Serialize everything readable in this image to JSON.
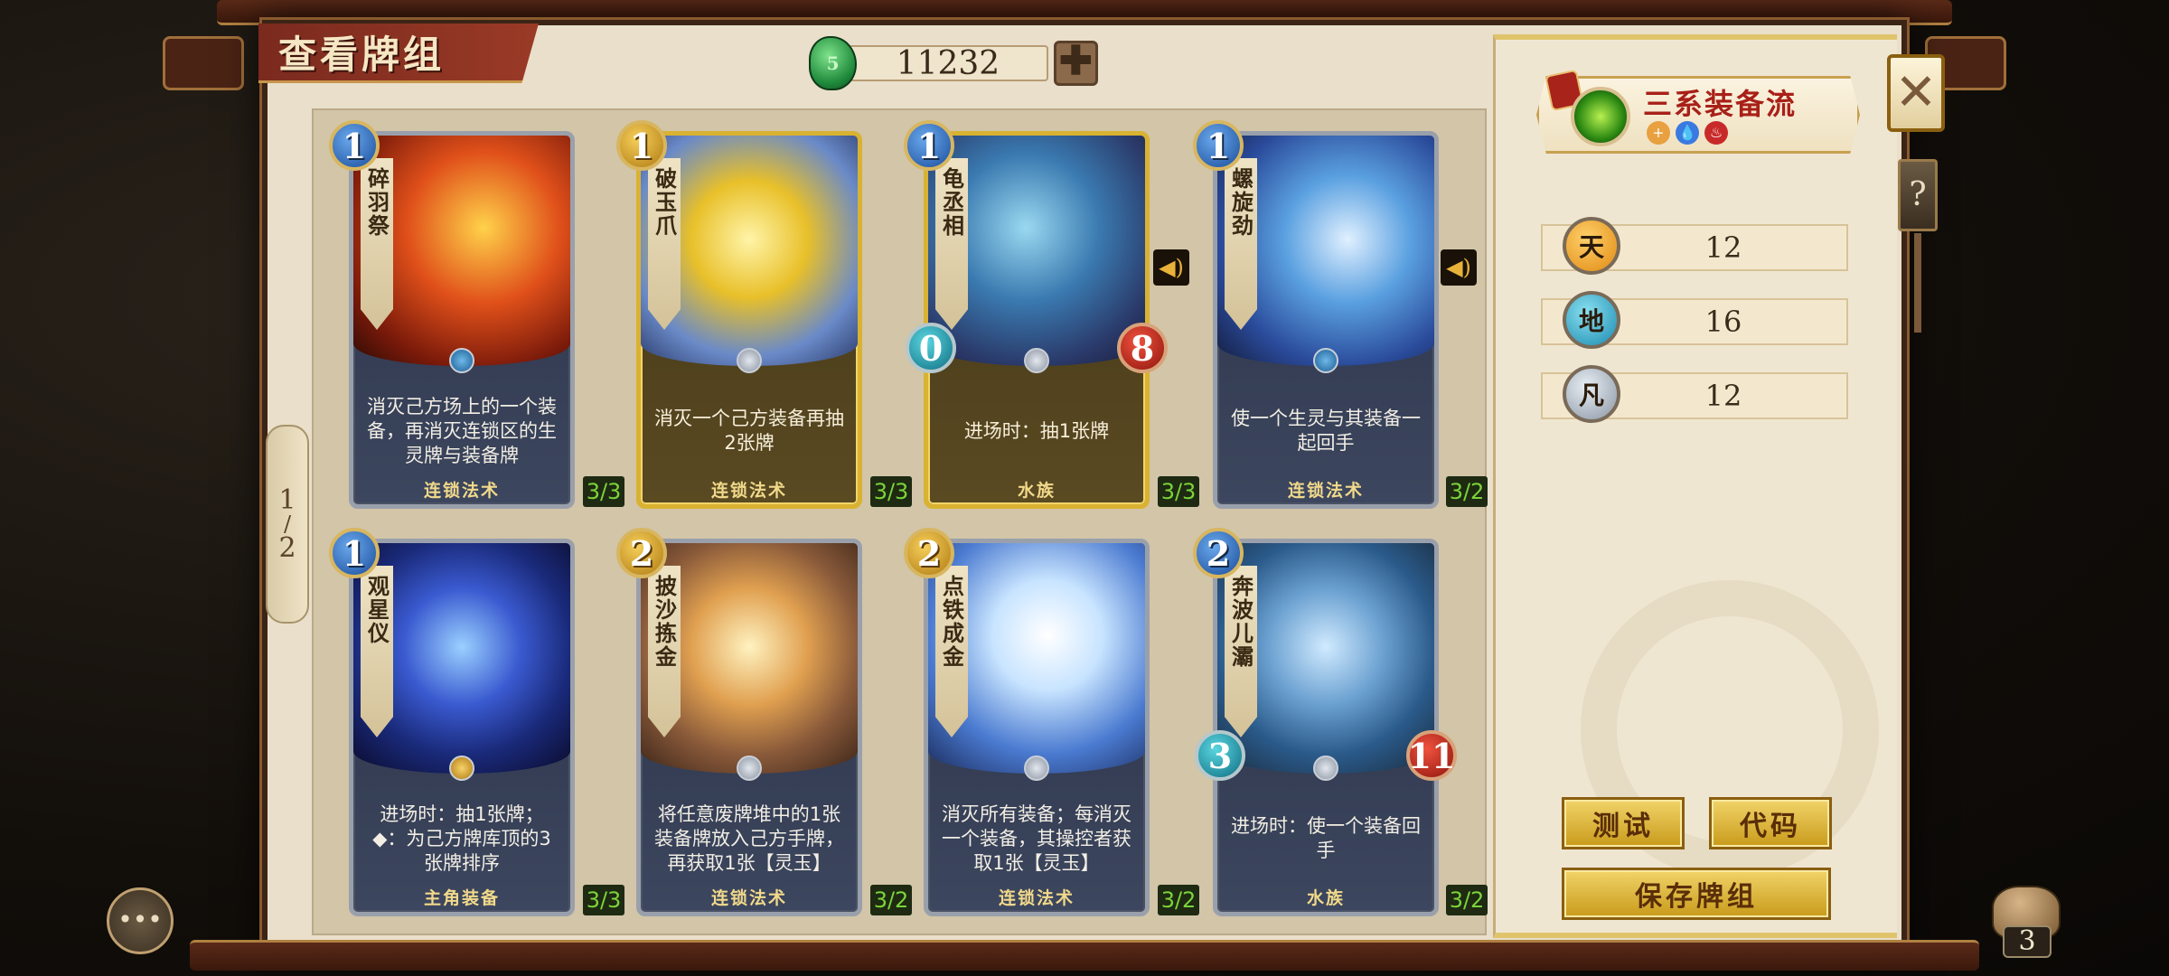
{
  "title": "查看牌组",
  "currency": {
    "jade_icon": "5",
    "amount": "11232",
    "add_label": "✚"
  },
  "pager": {
    "current": "1",
    "total": "2"
  },
  "cards": [
    {
      "name": "碎羽祭",
      "cost": "1",
      "desc": "消灭己方场上的一个装备，再消灭连锁区的生灵牌与装备牌",
      "type": "连锁法术",
      "count": "3/3"
    },
    {
      "name": "破玉爪",
      "cost": "1",
      "desc": "消灭一个己方装备再抽2张牌",
      "type": "连锁法术",
      "count": "3/3"
    },
    {
      "name": "龟丞相",
      "cost": "1",
      "atk": "0",
      "hp": "8",
      "desc": "进场时：抽1张牌",
      "type": "水族",
      "count": "3/3"
    },
    {
      "name": "螺旋劲",
      "cost": "1",
      "desc": "使一个生灵与其装备一起回手",
      "type": "连锁法术",
      "count": "3/2"
    },
    {
      "name": "观星仪",
      "cost": "1",
      "desc": "进场时：抽1张牌；◆：为己方牌库顶的3张牌排序",
      "type": "主角装备",
      "count": "3/3"
    },
    {
      "name": "披沙拣金",
      "cost": "2",
      "desc": "将任意废牌堆中的1张装备牌放入己方手牌，再获取1张【灵玉】",
      "type": "连锁法术",
      "count": "3/2"
    },
    {
      "name": "点铁成金",
      "cost": "2",
      "desc": "消灭所有装备；每消灭一个装备，其操控者获取1张【灵玉】",
      "type": "连锁法术",
      "count": "3/2"
    },
    {
      "name": "奔波儿灞",
      "cost": "2",
      "atk": "3",
      "hp": "11",
      "desc": "进场时：使一个装备回手",
      "type": "水族",
      "count": "3/2"
    }
  ],
  "deck": {
    "name": "三系装备流",
    "elements": [
      "+",
      "💧",
      "♨"
    ]
  },
  "stats": [
    {
      "label": "天",
      "value": "12"
    },
    {
      "label": "地",
      "value": "16"
    },
    {
      "label": "凡",
      "value": "12"
    }
  ],
  "buttons": {
    "test": "测试",
    "code": "代码",
    "save": "保存牌组"
  },
  "close_label": "✕",
  "help_label": "?",
  "chat_label": "•••",
  "bag_count": "3",
  "icons": {
    "speaker": "speaker-icon",
    "close": "close-icon",
    "help": "help-icon",
    "chat": "chat-icon",
    "bag": "bag-icon"
  }
}
